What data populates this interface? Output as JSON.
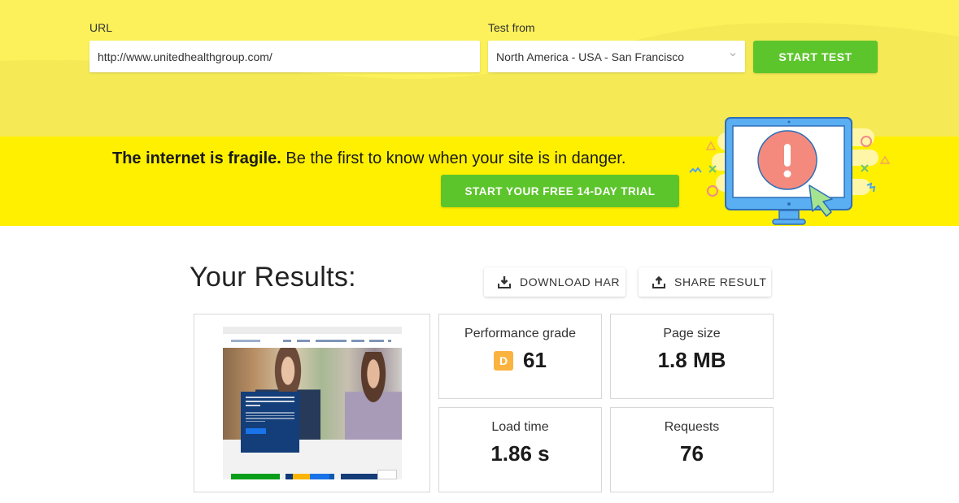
{
  "form": {
    "url_label": "URL",
    "url_value": "http://www.unitedhealthgroup.com/",
    "test_from_label": "Test from",
    "test_from_value": "North America - USA - San Francisco",
    "start_button": "START TEST"
  },
  "banner": {
    "bold_text": "The internet is fragile.",
    "text": " Be the first to know when your site is in danger.",
    "cta": "START YOUR FREE 14-DAY TRIAL",
    "illustration": "monitor-alert-illustration"
  },
  "results": {
    "title": "Your Results:",
    "download_label": "DOWNLOAD HAR",
    "share_label": "SHARE RESULT",
    "metrics": [
      {
        "label": "Performance grade",
        "grade": "D",
        "value": "61"
      },
      {
        "label": "Page size",
        "value": "1.8 MB"
      },
      {
        "label": "Load time",
        "value": "1.86 s"
      },
      {
        "label": "Requests",
        "value": "76"
      }
    ],
    "screenshot": {
      "description": "UnitedHealth Group homepage screenshot",
      "hero_heading": "What Health Care Can Do When It's Caring and Smart",
      "hero_button": "LEARN MORE"
    }
  },
  "colors": {
    "top_bg": "#f5ea55",
    "banner_bg": "#fff000",
    "green": "#5dc52c",
    "grade_d": "#fbb340"
  }
}
